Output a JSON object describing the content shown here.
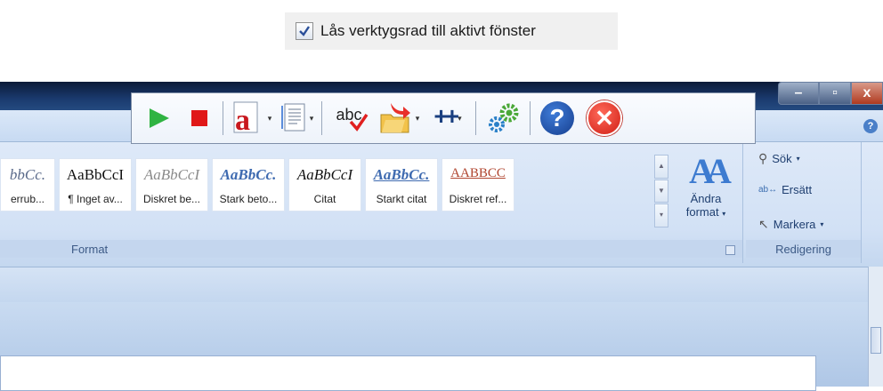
{
  "lock_toolbar": {
    "checked": true,
    "label": "Lås verktygsrad till aktivt fönster"
  },
  "window_buttons": {
    "minimize": "–",
    "maximize": "▫",
    "close": "x"
  },
  "help_icon_glyph": "?",
  "toolbar": {
    "abc_label": "abc",
    "help_glyph": "?",
    "close_glyph": "✕"
  },
  "styles_group": {
    "label": "Format",
    "tiles": [
      {
        "sample": "bbCc.",
        "name": "errub...",
        "color": "#5a6a8a",
        "italic": true,
        "bold": false
      },
      {
        "sample": "AaBbCcI",
        "name": "¶ Inget av...",
        "color": "#111111",
        "italic": false,
        "bold": false
      },
      {
        "sample": "AaBbCcI",
        "name": "Diskret be...",
        "color": "#8a8a8a",
        "italic": true,
        "bold": false
      },
      {
        "sample": "AaBbCc.",
        "name": "Stark beto...",
        "color": "#3e6ab0",
        "italic": true,
        "bold": true
      },
      {
        "sample": "AaBbCcI",
        "name": "Citat",
        "color": "#111111",
        "italic": true,
        "bold": false
      },
      {
        "sample": "AaBbCc.",
        "name": "Starkt citat",
        "color": "#3e6ab0",
        "italic": true,
        "bold": true
      },
      {
        "sample": "AABBCC",
        "name": "Diskret ref...",
        "color": "#b0452f",
        "italic": false,
        "bold": false
      }
    ],
    "change_format": {
      "icon": "AA",
      "label_line1": "Ändra",
      "label_line2": "format"
    }
  },
  "editing_group": {
    "label": "Redigering",
    "find": "Sök",
    "replace": "Ersätt",
    "select": "Markera"
  }
}
